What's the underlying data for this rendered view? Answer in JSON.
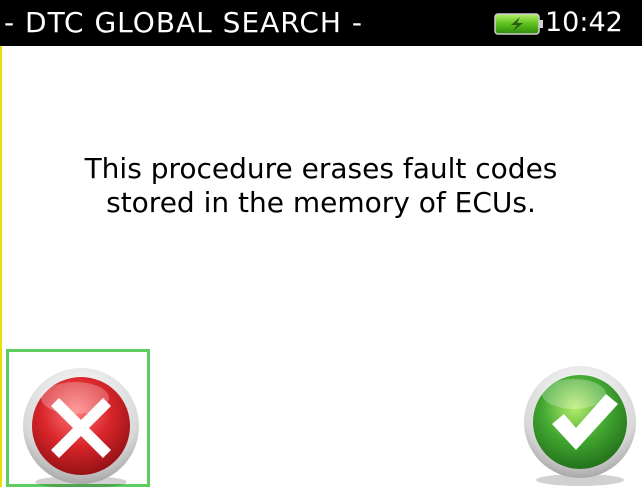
{
  "header": {
    "title": "- DTC GLOBAL SEARCH -",
    "time": "10:42",
    "battery_icon": "battery-charging-icon",
    "background_color": "#000000",
    "text_color": "#ffffff"
  },
  "main": {
    "message_lines": [
      "This procedure erases fault codes",
      "stored in the memory of ECUs."
    ]
  },
  "buttons": {
    "cancel_icon": "cross-icon",
    "cancel_color": "#d9262b",
    "confirm_icon": "checkmark-icon",
    "confirm_color": "#43a832",
    "selected_border_color": "#5fcc5f"
  }
}
